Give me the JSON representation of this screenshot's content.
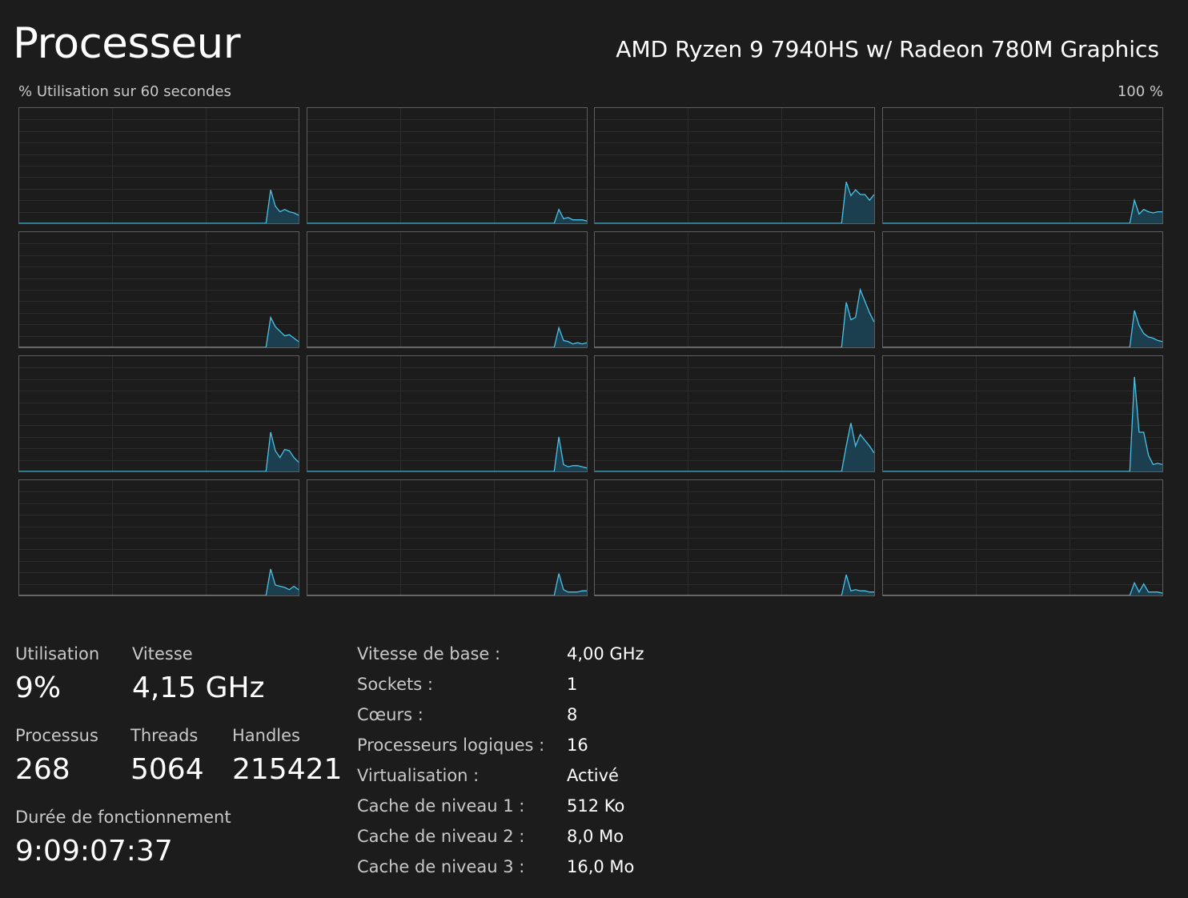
{
  "header": {
    "title": "Processeur",
    "cpu_model": "AMD Ryzen 9 7940HS w/ Radeon 780M Graphics"
  },
  "graph": {
    "caption": "% Utilisation sur 60 secondes",
    "max_label": "100 %",
    "line_color": "#4cc2e7",
    "fill_color": "#1b3f4e",
    "grid_color": "#2c2c2c",
    "border_color": "#5e5e5e"
  },
  "chart_data": {
    "type": "area",
    "x_range_seconds": [
      0,
      60
    ],
    "ylim": [
      0,
      100
    ],
    "grid": true,
    "legend": "none",
    "series": [
      {
        "x": [
          0,
          53,
          54,
          55,
          56,
          57,
          58,
          59,
          60
        ],
        "values": [
          0,
          0,
          29,
          15,
          10,
          12,
          10,
          9,
          7
        ]
      },
      {
        "x": [
          0,
          53,
          54,
          55,
          56,
          57,
          58,
          59,
          60
        ],
        "values": [
          0,
          0,
          12,
          4,
          5,
          3,
          3,
          3,
          2
        ]
      },
      {
        "x": [
          0,
          53,
          54,
          55,
          56,
          57,
          58,
          59,
          60
        ],
        "values": [
          0,
          0,
          36,
          24,
          29,
          25,
          25,
          20,
          25
        ]
      },
      {
        "x": [
          0,
          53,
          54,
          55,
          56,
          57,
          58,
          59,
          60
        ],
        "values": [
          0,
          0,
          20,
          8,
          12,
          10,
          9,
          10,
          10
        ]
      },
      {
        "x": [
          0,
          53,
          54,
          55,
          56,
          57,
          58,
          59,
          60
        ],
        "values": [
          0,
          0,
          26,
          18,
          14,
          10,
          11,
          8,
          5
        ]
      },
      {
        "x": [
          0,
          53,
          54,
          55,
          56,
          57,
          58,
          59,
          60
        ],
        "values": [
          0,
          0,
          17,
          6,
          5,
          3,
          4,
          3,
          4
        ]
      },
      {
        "x": [
          0,
          53,
          54,
          55,
          56,
          57,
          58,
          59,
          60
        ],
        "values": [
          0,
          0,
          39,
          24,
          26,
          50,
          40,
          30,
          22
        ]
      },
      {
        "x": [
          0,
          53,
          54,
          55,
          56,
          57,
          58,
          59,
          60
        ],
        "values": [
          0,
          0,
          32,
          19,
          12,
          9,
          8,
          6,
          5
        ]
      },
      {
        "x": [
          0,
          53,
          54,
          55,
          56,
          57,
          58,
          59,
          60
        ],
        "values": [
          0,
          0,
          34,
          18,
          12,
          19,
          18,
          12,
          8
        ]
      },
      {
        "x": [
          0,
          53,
          54,
          55,
          56,
          57,
          58,
          59,
          60
        ],
        "values": [
          0,
          0,
          30,
          6,
          4,
          5,
          5,
          4,
          3
        ]
      },
      {
        "x": [
          0,
          53,
          54,
          55,
          56,
          57,
          58,
          59,
          60
        ],
        "values": [
          0,
          0,
          22,
          42,
          22,
          32,
          27,
          22,
          16
        ]
      },
      {
        "x": [
          0,
          53,
          54,
          55,
          56,
          57,
          58,
          59,
          60
        ],
        "values": [
          0,
          0,
          82,
          34,
          34,
          14,
          6,
          7,
          6
        ]
      },
      {
        "x": [
          0,
          53,
          54,
          55,
          56,
          57,
          58,
          59,
          60
        ],
        "values": [
          0,
          0,
          23,
          9,
          8,
          7,
          5,
          8,
          5
        ]
      },
      {
        "x": [
          0,
          53,
          54,
          55,
          56,
          57,
          58,
          59,
          60
        ],
        "values": [
          0,
          0,
          19,
          5,
          3,
          3,
          3,
          4,
          4
        ]
      },
      {
        "x": [
          0,
          53,
          54,
          55,
          56,
          57,
          58,
          59,
          60
        ],
        "values": [
          0,
          0,
          18,
          4,
          5,
          4,
          4,
          3,
          3
        ]
      },
      {
        "x": [
          0,
          53,
          54,
          55,
          56,
          57,
          58,
          59,
          60
        ],
        "values": [
          0,
          0,
          11,
          3,
          10,
          3,
          3,
          3,
          2
        ]
      }
    ]
  },
  "stats": {
    "utilisation_label": "Utilisation",
    "utilisation_value": "9%",
    "vitesse_label": "Vitesse",
    "vitesse_value": "4,15 GHz",
    "processus_label": "Processus",
    "processus_value": "268",
    "threads_label": "Threads",
    "threads_value": "5064",
    "handles_label": "Handles",
    "handles_value": "215421",
    "uptime_label": "Durée de fonctionnement",
    "uptime_value": "9:09:07:37"
  },
  "specs": [
    {
      "label": "Vitesse de base :",
      "value": "4,00 GHz"
    },
    {
      "label": "Sockets :",
      "value": "1"
    },
    {
      "label": "Cœurs :",
      "value": "8"
    },
    {
      "label": "Processeurs logiques :",
      "value": "16"
    },
    {
      "label": "Virtualisation :",
      "value": "Activé"
    },
    {
      "label": "Cache de niveau 1 :",
      "value": "512 Ko"
    },
    {
      "label": "Cache de niveau 2 :",
      "value": "8,0 Mo"
    },
    {
      "label": "Cache de niveau 3 :",
      "value": "16,0 Mo"
    }
  ]
}
